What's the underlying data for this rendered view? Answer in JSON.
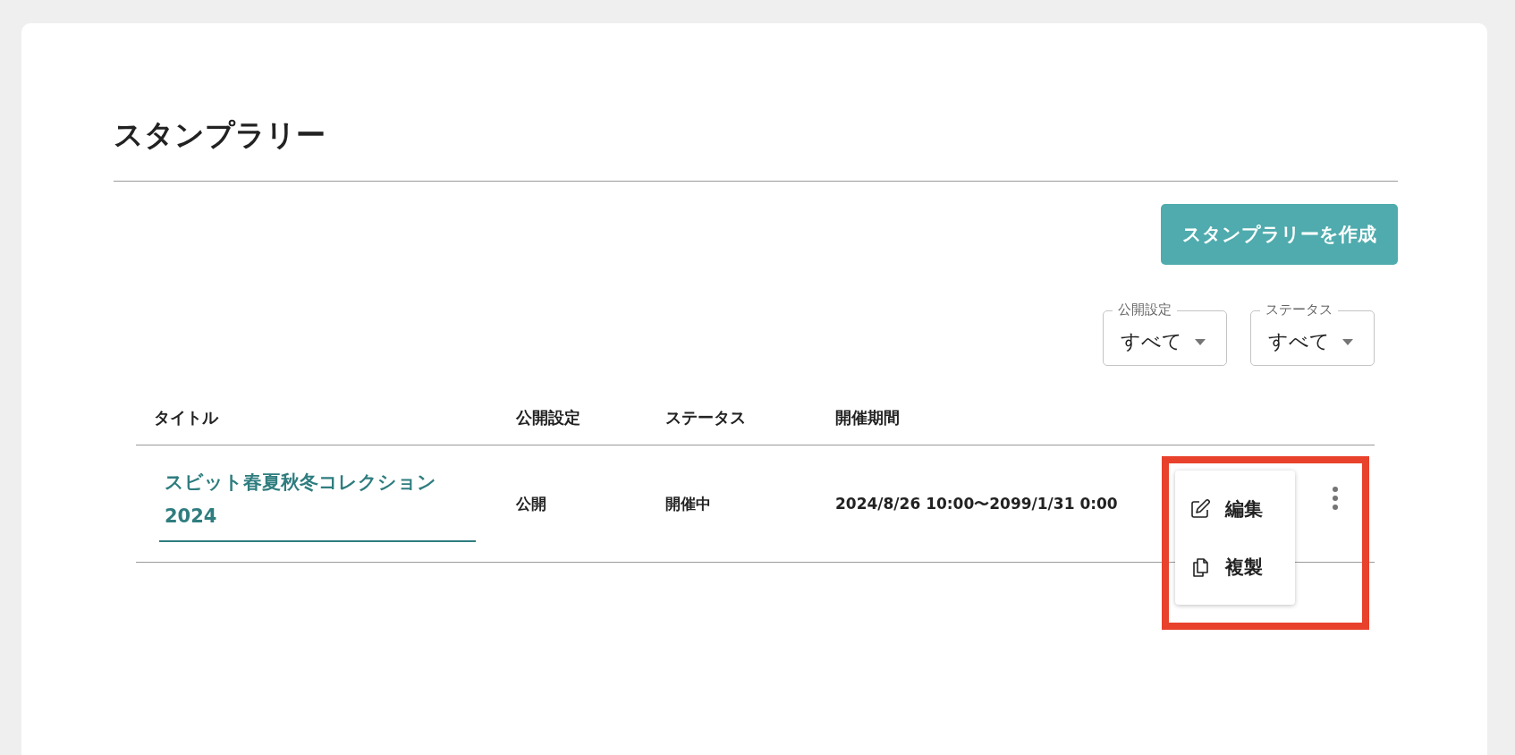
{
  "page": {
    "title": "スタンプラリー"
  },
  "create_button": {
    "label": "スタンプラリーを作成"
  },
  "filters": [
    {
      "label": "公開設定",
      "value": "すべて"
    },
    {
      "label": "ステータス",
      "value": "すべて"
    }
  ],
  "table": {
    "columns": [
      "タイトル",
      "公開設定",
      "ステータス",
      "開催期間"
    ],
    "rows": [
      {
        "title": "スビット春夏秋冬コレクション2024",
        "visibility": "公開",
        "status": "開催中",
        "period": "2024/8/26 10:00〜2099/1/31 0:00",
        "menu_open": true
      }
    ]
  },
  "row_menu": {
    "items": [
      {
        "kind": "edit",
        "label": "編集"
      },
      {
        "kind": "duplicate",
        "label": "複製"
      }
    ]
  }
}
